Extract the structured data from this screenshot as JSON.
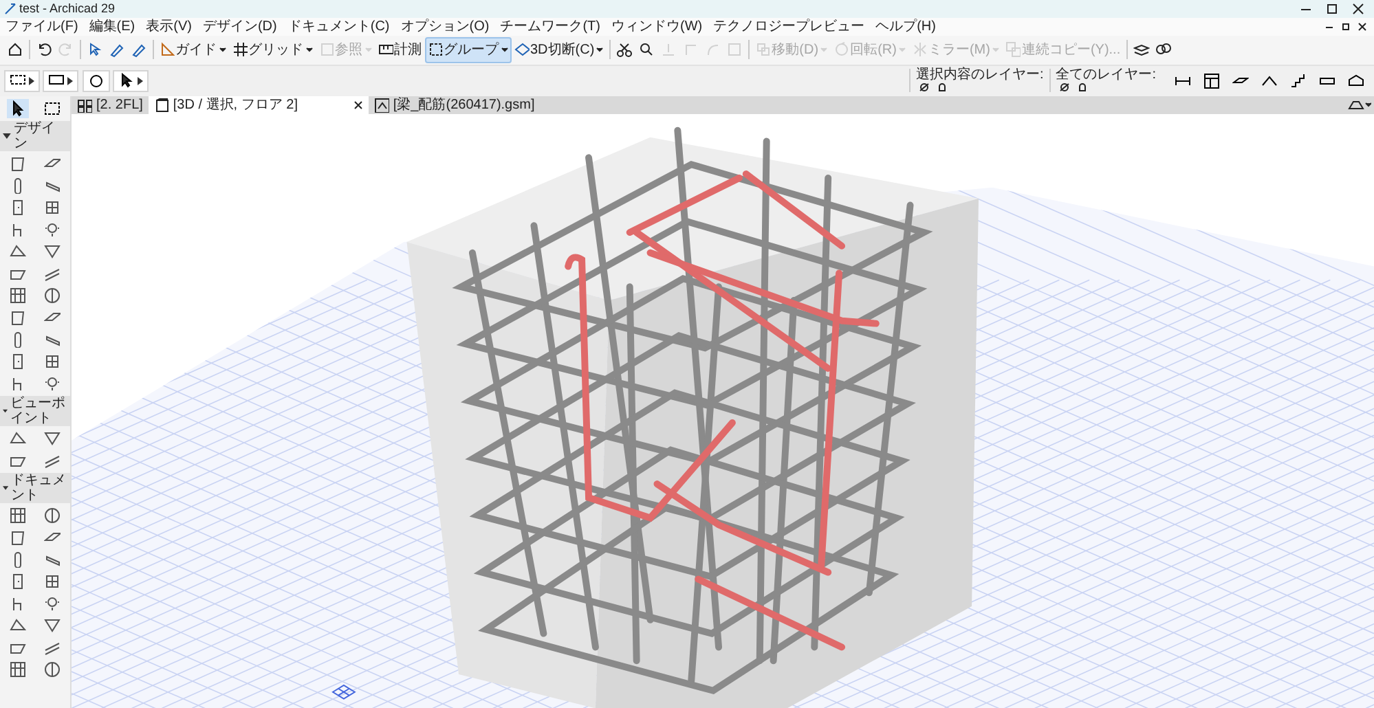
{
  "window": {
    "title": "test - Archicad 29"
  },
  "menu": [
    {
      "label": "ファイル(F)"
    },
    {
      "label": "編集(E)"
    },
    {
      "label": "表示(V)"
    },
    {
      "label": "デザイン(D)"
    },
    {
      "label": "ドキュメント(C)"
    },
    {
      "label": "オプション(O)"
    },
    {
      "label": "チームワーク(T)"
    },
    {
      "label": "ウィンドウ(W)"
    },
    {
      "label": "テクノロジープレビュー"
    },
    {
      "label": "ヘルプ(H)"
    }
  ],
  "toolbar": [
    {
      "kind": "icon",
      "disabled": false
    },
    {
      "kind": "separator"
    },
    {
      "kind": "icon",
      "disabled": false
    },
    {
      "kind": "icon",
      "disabled": true
    },
    {
      "kind": "separator"
    },
    {
      "kind": "icon",
      "disabled": false
    },
    {
      "kind": "icon",
      "disabled": false
    },
    {
      "kind": "icon",
      "disabled": false
    },
    {
      "kind": "separator"
    },
    {
      "kind": "text",
      "label": "ガイド",
      "dropdown": true,
      "disabled": false,
      "selected": false
    },
    {
      "kind": "text",
      "label": "グリッド",
      "dropdown": true,
      "disabled": false,
      "selected": false
    },
    {
      "kind": "text",
      "label": "参照",
      "dropdown": true,
      "disabled": true,
      "selected": false
    },
    {
      "kind": "text",
      "label": "計測",
      "dropdown": false,
      "disabled": false,
      "selected": false
    },
    {
      "kind": "text",
      "label": "グループ",
      "dropdown": true,
      "disabled": false,
      "selected": true
    },
    {
      "kind": "text",
      "label": "3D切断(C)",
      "dropdown": true,
      "disabled": false,
      "selected": false
    },
    {
      "kind": "separator"
    },
    {
      "kind": "icon",
      "disabled": false
    },
    {
      "kind": "icon",
      "disabled": false
    },
    {
      "kind": "icon",
      "disabled": true
    },
    {
      "kind": "icon",
      "disabled": true
    },
    {
      "kind": "icon",
      "disabled": true
    },
    {
      "kind": "icon",
      "disabled": true
    },
    {
      "kind": "separator"
    },
    {
      "kind": "text",
      "label": "移動(D)",
      "dropdown": true,
      "disabled": true,
      "selected": false
    },
    {
      "kind": "text",
      "label": "回転(R)",
      "dropdown": true,
      "disabled": true,
      "selected": false
    },
    {
      "kind": "text",
      "label": "ミラー(M)",
      "dropdown": true,
      "disabled": true,
      "selected": false
    },
    {
      "kind": "text",
      "label": "連続コピー(Y)...",
      "dropdown": false,
      "disabled": true,
      "selected": false
    },
    {
      "kind": "separator"
    },
    {
      "kind": "icon",
      "disabled": false
    },
    {
      "kind": "icon",
      "disabled": false
    },
    {
      "kind": "layers",
      "label": "選択内容のレイヤー:"
    },
    {
      "kind": "layers",
      "label": "全てのレイヤー:"
    }
  ],
  "toolbox": {
    "sections": [
      {
        "title": "デザイン",
        "expanded": true
      },
      {
        "title": "ビューポイント",
        "expanded": true
      },
      {
        "title": "ドキュメント",
        "expanded": true
      }
    ]
  },
  "tabs": [
    {
      "label": "[2. 2FL]",
      "selected": false
    },
    {
      "label": "[3D / 選択, フロア 2]",
      "selected": true
    },
    {
      "label": "[梁_配筋(260417).gsm]",
      "selected": false
    }
  ]
}
